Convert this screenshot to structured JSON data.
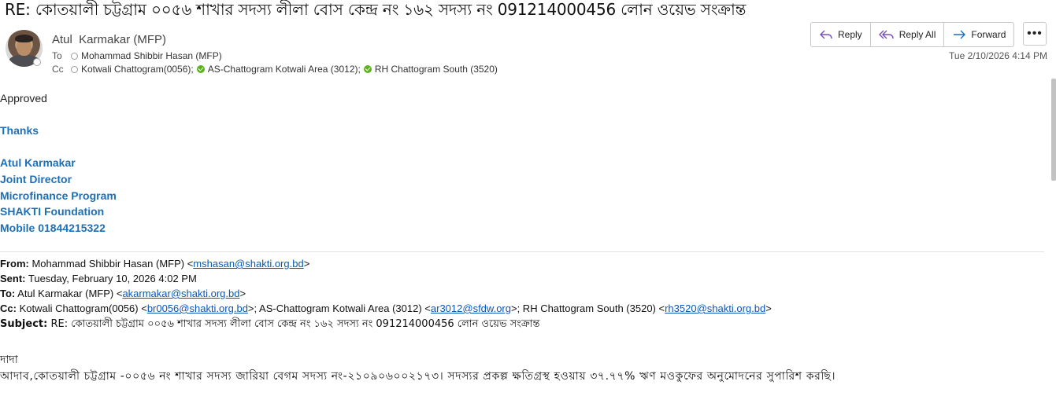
{
  "email": {
    "subject": "RE: কোতয়ালী চট্টগ্রাম ০০৫৬ শাখার সদস্য লীলা বোস  কেন্দ্র নং ১৬২ সদস্য নং 091214000456  লোন ওয়েভ সংক্রান্ত",
    "sender": "Atul  Karmakar (MFP)",
    "to_label": "To",
    "to": "Mohammad Shibbir Hasan (MFP)",
    "cc_label": "Cc",
    "cc": [
      "Kotwali Chattogram(0056);",
      "AS-Chattogram  Kotwali Area (3012);",
      "RH Chattogram South (3520)"
    ],
    "date": "Tue 2/10/2026 4:14 PM"
  },
  "toolbar": {
    "reply": "Reply",
    "reply_all": "Reply All",
    "forward": "Forward",
    "more": "•••"
  },
  "body": {
    "greeting": "Approved",
    "thanks": "Thanks",
    "signature": [
      "Atul Karmakar",
      "Joint Director",
      "Microfinance Program",
      "SHAKTI Foundation",
      "Mobile 01844215322"
    ]
  },
  "quoted": {
    "from_label": "From:",
    "from_name": "Mohammad Shibbir Hasan (MFP) <",
    "from_email": "mshasan@shakti.org.bd",
    "sent_label": "Sent:",
    "sent": "Tuesday, February 10, 2026 4:02 PM",
    "to_label": "To:",
    "to_name": "Atul Karmakar (MFP) <",
    "to_email": "akarmakar@shakti.org.bd",
    "cc_label": "Cc:",
    "cc_1": "Kotwali Chattogram(0056) <",
    "cc_1_email": "br0056@shakti.org.bd",
    "cc_2": ">; AS-Chattogram Kotwali Area (3012) <",
    "cc_2_email": "ar3012@sfdw.org",
    "cc_3": ">; RH Chattogram South (3520) <",
    "cc_3_email": "rh3520@shakti.org.bd",
    "subject_label": "Subject:",
    "subject": "RE: কোতয়ালী চট্টগ্রাম ০০৫৬ শাখার সদস্য লীলা বোস কেন্দ্র নং ১৬২ সদস্য নং 091214000456 লোন ওয়েভ সংক্রান্ত",
    "salutation": "দাদা",
    "body_line": "আদাব,কোতয়ালী চট্টগ্রাম -০০৫৬ নং শাখার সদস্য জারিয়া বেগম সদস্য নং-২১০৯০৬০০২১৭৩।   সদস্যর প্রকল্প ক্ষতিগ্রস্থ   হওয়ায়   ৩৭.৭৭% ঋণ মওকুফের অনুমোদনের সুপারিশ করছি।"
  },
  "colors": {
    "signature": "#1f6fb5",
    "link": "#0b57b5",
    "accept": "#5bb31a"
  }
}
